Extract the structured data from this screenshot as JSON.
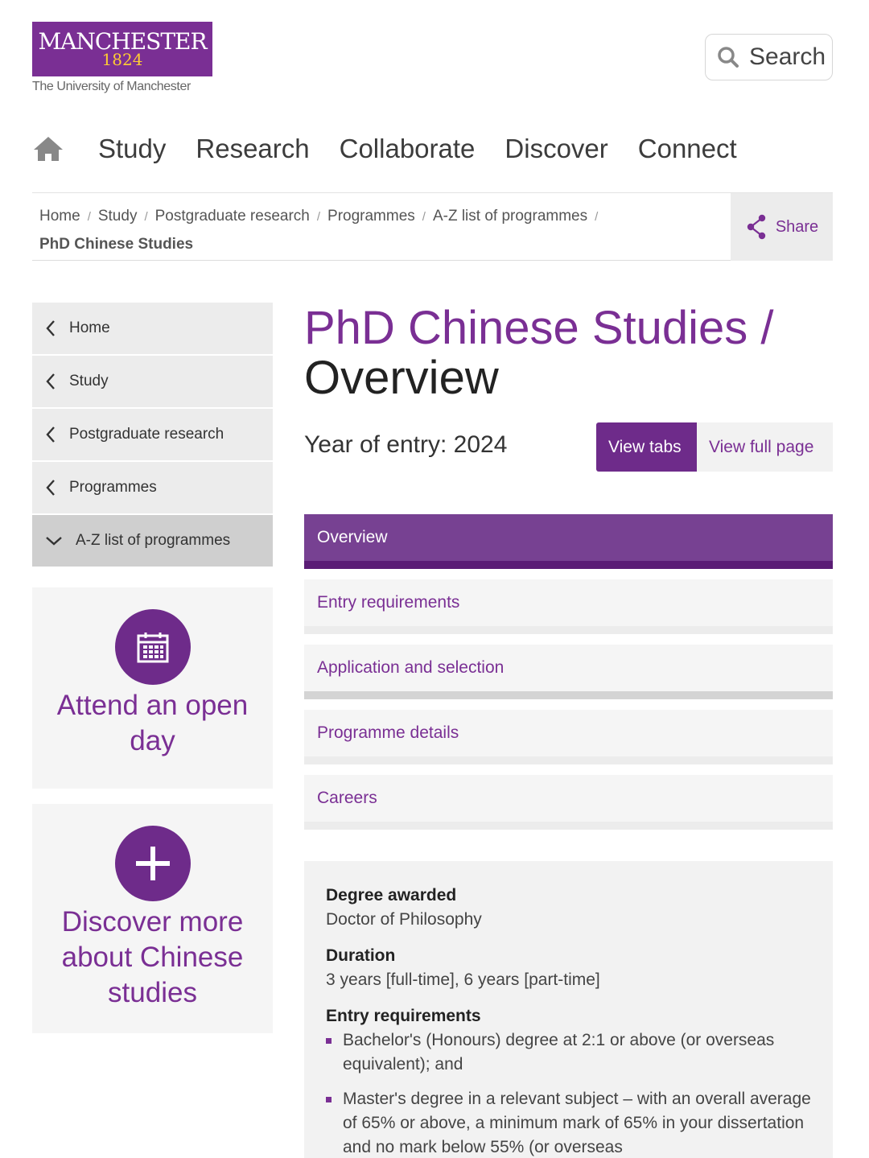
{
  "header": {
    "logo": {
      "name": "MANCHESTER",
      "year": "1824",
      "subtitle": "The University of Manchester"
    },
    "search": {
      "label": "Search",
      "icon": "search-icon"
    }
  },
  "mainnav": {
    "home_icon": "home-icon",
    "items": [
      "Study",
      "Research",
      "Collaborate",
      "Discover",
      "Connect"
    ]
  },
  "breadcrumb": {
    "items": [
      "Home",
      "Study",
      "Postgraduate research",
      "Programmes",
      "A-Z list of programmes"
    ],
    "separator": "/",
    "current": "PhD Chinese Studies",
    "share_label": "Share"
  },
  "sidenav": {
    "items": [
      {
        "label": "Home",
        "icon": "chevron-left-icon"
      },
      {
        "label": "Study",
        "icon": "chevron-left-icon"
      },
      {
        "label": "Postgraduate research",
        "icon": "chevron-left-icon"
      },
      {
        "label": "Programmes",
        "icon": "chevron-left-icon"
      },
      {
        "label": "A-Z list of programmes",
        "icon": "chevron-down-icon"
      }
    ]
  },
  "ctas": [
    {
      "label": "Attend an open day",
      "icon": "calendar-icon"
    },
    {
      "label": "Discover more about Chinese studies",
      "icon": "plus-icon"
    }
  ],
  "page": {
    "title": "PhD Chinese Studies /",
    "subtitle": "Overview",
    "year_of_entry": "Year of entry: 2024",
    "view_tabs": "View tabs",
    "view_full_page": "View full page"
  },
  "tabs": [
    "Overview",
    "Entry requirements",
    "Application and selection",
    "Programme details",
    "Careers"
  ],
  "facts": {
    "degree_heading": "Degree awarded",
    "degree_value": "Doctor of Philosophy",
    "duration_heading": "Duration",
    "duration_value": "3 years [full-time], 6 years [part-time]",
    "entry_heading": "Entry requirements",
    "entry_items": [
      "Bachelor's (Honours) degree at 2:1 or above (or overseas equivalent); and",
      "Master's degree in a relevant subject – with an overall average of 65% or above, a minimum mark of 65% in your dissertation and no mark below 55% (or overseas"
    ]
  },
  "colors": {
    "brand_purple": "#7a2f94",
    "brand_gold": "#ffcc33",
    "tab_active": "#774192"
  }
}
